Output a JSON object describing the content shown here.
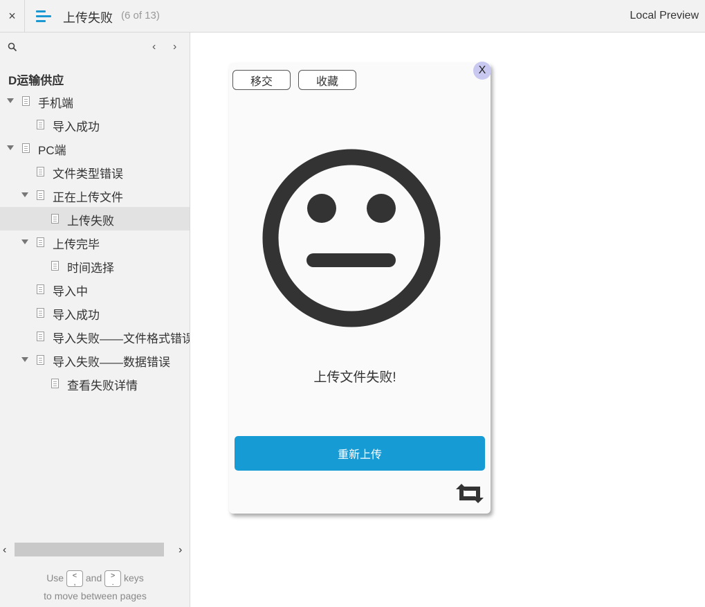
{
  "header": {
    "close_label": "×",
    "title": "上传失败",
    "page_count": "(6 of 13)",
    "right_label": "Local Preview"
  },
  "sidebar": {
    "nav_prev": "‹",
    "nav_next": "›",
    "project_title": "D运输供应",
    "items": [
      {
        "label": "手机端",
        "expandable": true,
        "level": 0,
        "selected": false
      },
      {
        "label": "导入成功",
        "expandable": false,
        "level": 1,
        "selected": false
      },
      {
        "label": "PC端",
        "expandable": true,
        "level": 0,
        "selected": false
      },
      {
        "label": "文件类型错误",
        "expandable": false,
        "level": 1,
        "selected": false
      },
      {
        "label": "正在上传文件",
        "expandable": true,
        "level": 1,
        "selected": false
      },
      {
        "label": "上传失败",
        "expandable": false,
        "level": 2,
        "selected": true
      },
      {
        "label": "上传完毕",
        "expandable": true,
        "level": 1,
        "selected": false
      },
      {
        "label": "时间选择",
        "expandable": false,
        "level": 2,
        "selected": false
      },
      {
        "label": "导入中",
        "expandable": false,
        "level": 1,
        "selected": false
      },
      {
        "label": "导入成功",
        "expandable": false,
        "level": 1,
        "selected": false
      },
      {
        "label": "导入失败——文件格式错误",
        "expandable": false,
        "level": 1,
        "selected": false
      },
      {
        "label": "导入失败——数据错误",
        "expandable": true,
        "level": 1,
        "selected": false
      },
      {
        "label": "查看失败详情",
        "expandable": false,
        "level": 2,
        "selected": false
      }
    ],
    "scroll_left": "‹",
    "scroll_right": "›",
    "hint": {
      "use": "Use",
      "key_prev": "<\n,",
      "and": "and",
      "key_next": ">\n.",
      "keys": "keys",
      "line2": "to move between pages"
    }
  },
  "dialog": {
    "transfer_label": "移交",
    "favorite_label": "收藏",
    "close_label": "X",
    "message": "上传文件失败!",
    "retry_label": "重新上传"
  },
  "colors": {
    "accent": "#179bd4",
    "face": "#333333",
    "close_badge": "#c8c8f0"
  }
}
